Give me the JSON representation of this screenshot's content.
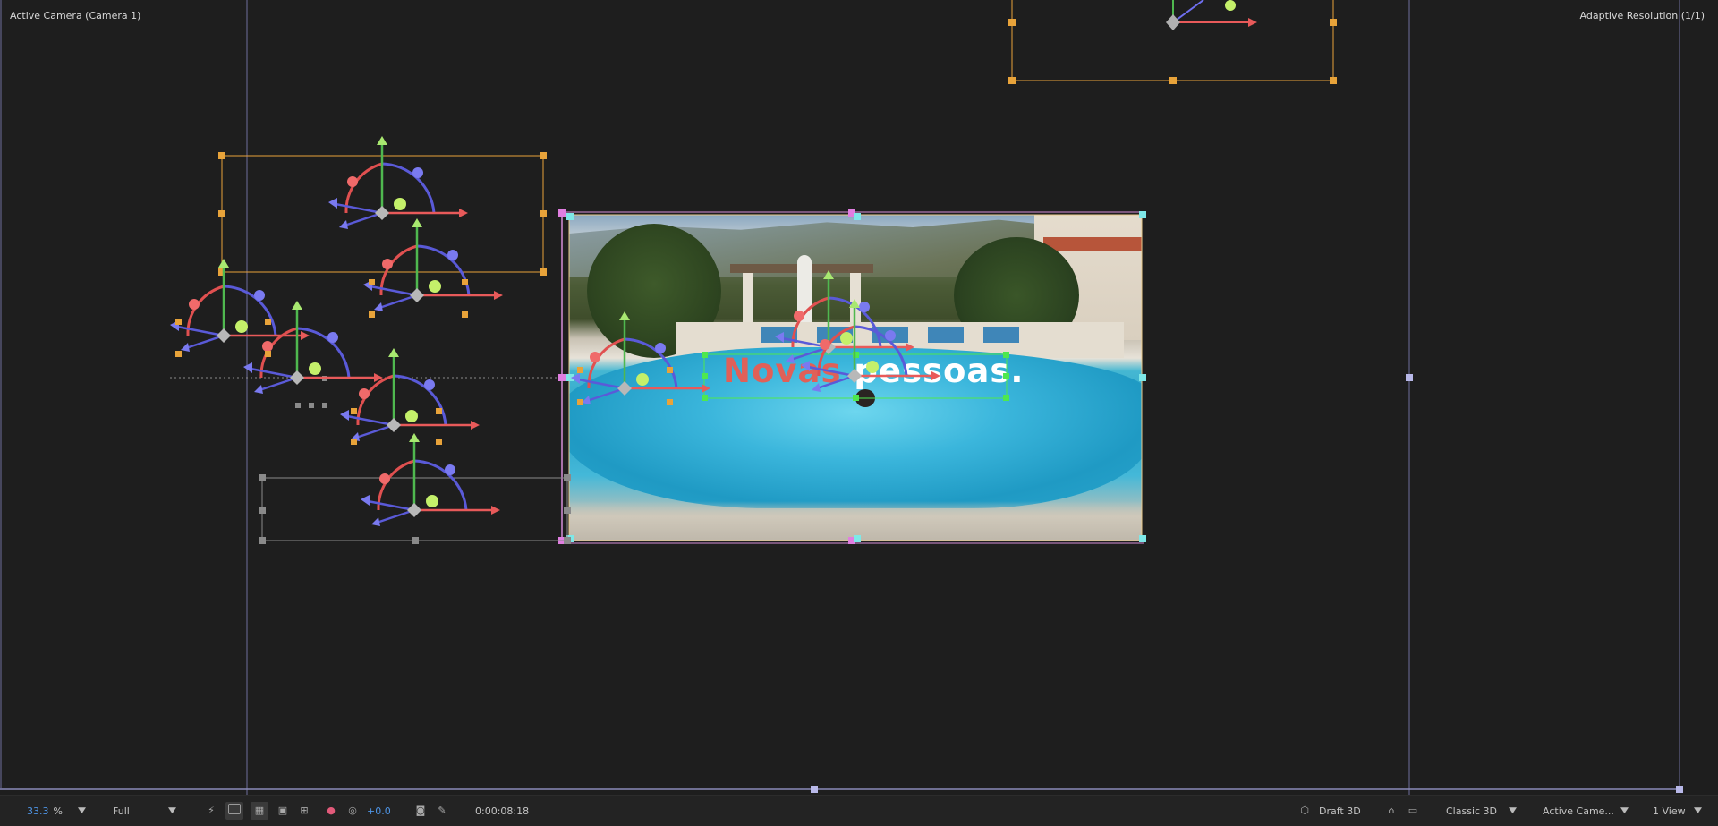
{
  "viewer": {
    "camera_label": "Active Camera (Camera 1)",
    "resolution_label": "Adaptive Resolution (1/1)"
  },
  "composition": {
    "text_word_1": "Novas",
    "text_word_2": "pessoas."
  },
  "toolbar": {
    "zoom_value": "33.3",
    "zoom_unit": "%",
    "resolution": "Full",
    "exposure": "+0.0",
    "timecode": "0:00:08:18",
    "renderer": "Draft 3D",
    "renderer_mode": "Classic 3D",
    "view_camera": "Active Came...",
    "view_layout": "1 View"
  },
  "colors": {
    "background": "#1e1e1e",
    "accent_blue": "#4e95e6",
    "handle_orange": "#e8a33a",
    "axis_x": "#e85a5a",
    "axis_y": "#9be05a",
    "axis_z": "#6f6ff0"
  },
  "icons": [
    "chevron-down-icon",
    "region-of-interest-icon",
    "transparency-grid-icon",
    "mask-visibility-icon",
    "safe-margins-icon",
    "grid-icon",
    "channels-icon",
    "reset-exposure-icon",
    "snapshot-icon",
    "show-snapshot-icon",
    "draft-3d-icon",
    "extended-viewer-icon",
    "fast-preview-icon"
  ]
}
